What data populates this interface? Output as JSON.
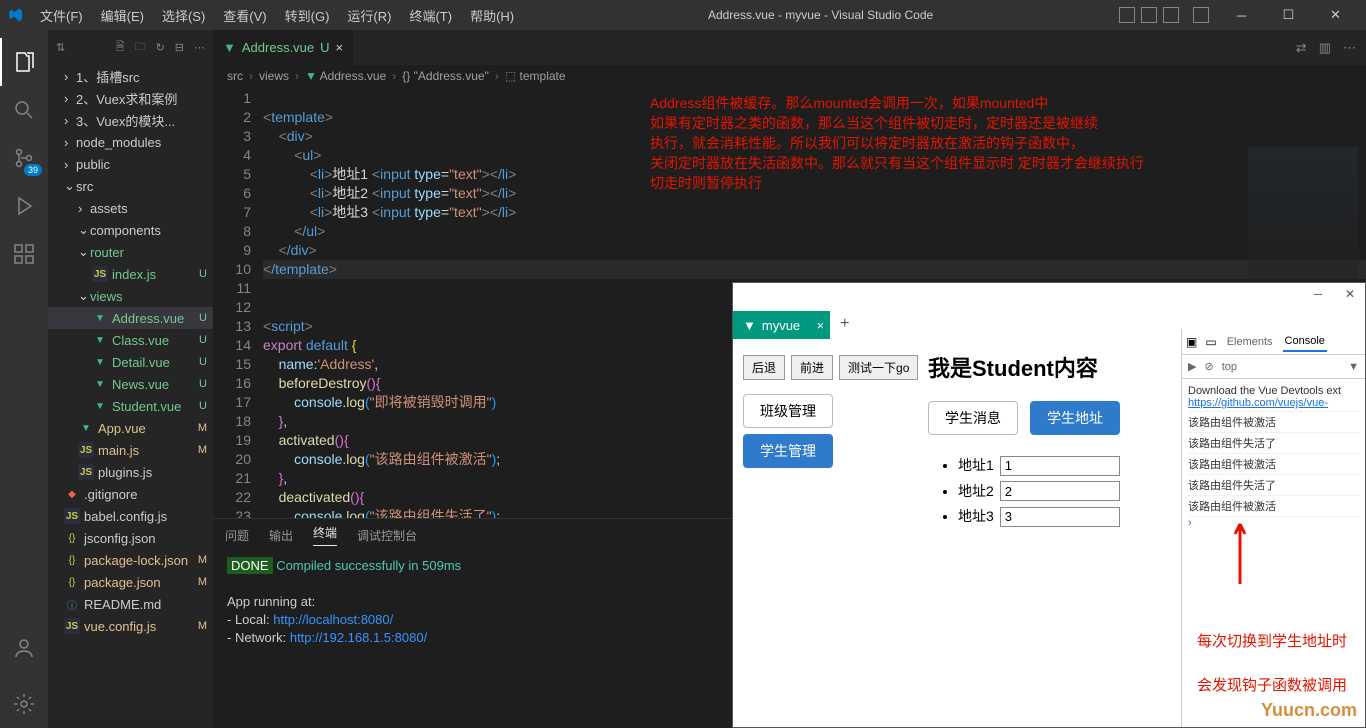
{
  "titlebar": {
    "menu": [
      "文件(F)",
      "编辑(E)",
      "选择(S)",
      "查看(V)",
      "转到(G)",
      "运行(R)",
      "终端(T)",
      "帮助(H)"
    ],
    "title": "Address.vue - myvue - Visual Studio Code"
  },
  "activity": {
    "badge": "39"
  },
  "sidebar": {
    "header_icons": [
      "⇅",
      "⧉",
      "↻",
      "⊟",
      "⋯"
    ],
    "tree": [
      {
        "indent": 1,
        "chev": "›",
        "label": "1、插槽src",
        "cls": ""
      },
      {
        "indent": 1,
        "chev": "›",
        "label": "2、Vuex求和案例",
        "cls": ""
      },
      {
        "indent": 1,
        "chev": "›",
        "label": "3、Vuex的模块...",
        "cls": ""
      },
      {
        "indent": 1,
        "chev": "›",
        "label": "node_modules",
        "cls": "dim"
      },
      {
        "indent": 1,
        "chev": "›",
        "label": "public",
        "cls": ""
      },
      {
        "indent": 1,
        "chev": "⌄",
        "label": "src",
        "cls": "",
        "folder": true
      },
      {
        "indent": 2,
        "chev": "›",
        "label": "assets",
        "cls": ""
      },
      {
        "indent": 2,
        "chev": "⌄",
        "label": "components",
        "cls": ""
      },
      {
        "indent": 2,
        "chev": "⌄",
        "label": "router",
        "cls": "green-text"
      },
      {
        "indent": 3,
        "icon": "js",
        "label": "index.js",
        "status": "U",
        "cls": "green-text"
      },
      {
        "indent": 2,
        "chev": "⌄",
        "label": "views",
        "cls": "green-text"
      },
      {
        "indent": 3,
        "icon": "vue",
        "label": "Address.vue",
        "status": "U",
        "cls": "green-text",
        "selected": true
      },
      {
        "indent": 3,
        "icon": "vue",
        "label": "Class.vue",
        "status": "U",
        "cls": "green-text"
      },
      {
        "indent": 3,
        "icon": "vue",
        "label": "Detail.vue",
        "status": "U",
        "cls": "green-text"
      },
      {
        "indent": 3,
        "icon": "vue",
        "label": "News.vue",
        "status": "U",
        "cls": "green-text"
      },
      {
        "indent": 3,
        "icon": "vue",
        "label": "Student.vue",
        "status": "U",
        "cls": "green-text"
      },
      {
        "indent": 2,
        "icon": "vue",
        "label": "App.vue",
        "status": "M",
        "cls": "orange-text"
      },
      {
        "indent": 2,
        "icon": "js",
        "label": "main.js",
        "status": "M",
        "cls": "orange-text"
      },
      {
        "indent": 2,
        "icon": "js",
        "label": "plugins.js",
        "cls": ""
      },
      {
        "indent": 1,
        "icon": "git",
        "label": ".gitignore",
        "cls": ""
      },
      {
        "indent": 1,
        "icon": "js",
        "label": "babel.config.js",
        "cls": ""
      },
      {
        "indent": 1,
        "icon": "json",
        "label": "jsconfig.json",
        "cls": ""
      },
      {
        "indent": 1,
        "icon": "json",
        "label": "package-lock.json",
        "status": "M",
        "cls": "orange-text"
      },
      {
        "indent": 1,
        "icon": "json",
        "label": "package.json",
        "status": "M",
        "cls": "orange-text"
      },
      {
        "indent": 1,
        "icon": "readme",
        "label": "README.md",
        "cls": ""
      },
      {
        "indent": 1,
        "icon": "js",
        "label": "vue.config.js",
        "status": "M",
        "cls": "orange-text"
      }
    ]
  },
  "tab": {
    "label": "Address.vue",
    "status": "U"
  },
  "breadcrumb": [
    "src",
    "views",
    "Address.vue",
    "{} \"Address.vue\"",
    "template"
  ],
  "code_lines": [
    1,
    2,
    3,
    4,
    5,
    6,
    7,
    8,
    9,
    10,
    11,
    12,
    13,
    14,
    15,
    16,
    17,
    18,
    19,
    20,
    21,
    22,
    23
  ],
  "code_text": {
    "l1": "template",
    "l2": "div",
    "l3": "ul",
    "l4a": "li",
    "l4b": "地址1 ",
    "l4c": "input",
    "l4d": "type",
    "l4e": "\"text\"",
    "l4f": "/li",
    "l5a": "li",
    "l5b": "地址2 ",
    "l5c": "input",
    "l5d": "type",
    "l5e": "\"text\"",
    "l5f": "/li",
    "l6a": "li",
    "l6b": "地址3 ",
    "l6c": "input",
    "l6d": "type",
    "l6e": "\"text\"",
    "l6f": "/li",
    "l7": "/ul",
    "l8": "/div",
    "l9": "/template",
    "l11": "script",
    "l12a": "export",
    "l12b": "default",
    "l13a": "name",
    "l13b": "'Address'",
    "l14": "beforeDestroy",
    "l15a": "console",
    "l15b": "log",
    "l15c": "\"即将被销毁时调用\"",
    "l17": "activated",
    "l18a": "console",
    "l18b": "log",
    "l18c": "\"该路由组件被激活\"",
    "l20": "deactivated",
    "l21a": "console",
    "l21b": "log",
    "l21c": "\"该路由组件失活了\""
  },
  "annotation": {
    "l1": "Address组件被缓存。那么mounted会调用一次，如果mounted中",
    "l2": "如果有定时器之类的函数，那么当这个组件被切走时，定时器还是被继续",
    "l3": "执行，就会消耗性能。所以我们可以将定时器放在激活的钩子函数中，",
    "l4": "关闭定时器放在失活函数中。那么就只有当这个组件显示时 定时器才会继续执行",
    "l5": "切走时则暂停执行"
  },
  "terminal": {
    "tabs": [
      "问题",
      "输出",
      "终端",
      "调试控制台"
    ],
    "done": "DONE",
    "msg": "Compiled successfully in 509ms",
    "running": "App running at:",
    "local_label": "- Local:   ",
    "local_url": "http://localhost:8080/",
    "net_label": "- Network: ",
    "net_url": "http://192.168.1.5:8080/"
  },
  "browser": {
    "tab": "myvue",
    "newtab": "+",
    "nav": [
      "后退",
      "前进",
      "测试一下go"
    ],
    "side": [
      "班级管理",
      "学生管理"
    ],
    "heading": "我是Student内容",
    "subtabs": [
      "学生消息",
      "学生地址"
    ],
    "list": [
      {
        "label": "地址1",
        "value": "1"
      },
      {
        "label": "地址2",
        "value": "2"
      },
      {
        "label": "地址3",
        "value": "3"
      }
    ]
  },
  "devtools": {
    "tabs": [
      "Elements",
      "Console"
    ],
    "filter": "top",
    "download": "Download the Vue Devtools ext",
    "link": "https://github.com/vuejs/vue-",
    "logs": [
      "该路由组件被激活",
      "该路由组件失活了",
      "该路由组件被激活",
      "该路由组件失活了",
      "该路由组件被激活"
    ],
    "prompt": "›",
    "note1": "每次切换到学生地址时",
    "note2": "会发现钩子函数被调用",
    "watermark": "Yuucn.com"
  }
}
